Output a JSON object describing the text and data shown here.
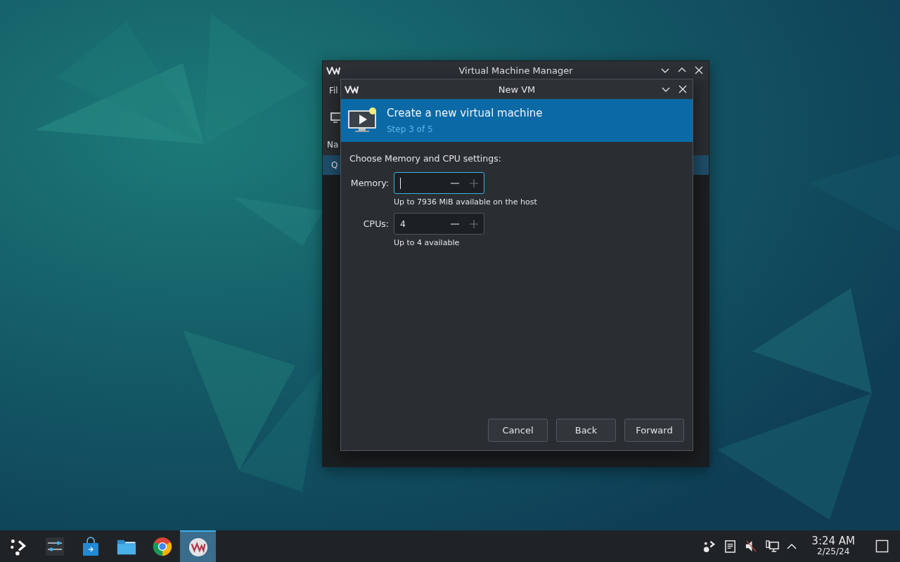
{
  "main_window": {
    "title": "Virtual Machine Manager",
    "menu_text": "Fil",
    "column_text": "Na",
    "row_text": "Q"
  },
  "dialog": {
    "title": "New VM",
    "header_title": "Create a new virtual machine",
    "header_step": "Step 3 of 5",
    "prompt": "Choose Memory and CPU settings:",
    "fields": [
      {
        "label": "Memory:",
        "focused": true,
        "hint": "Up to 7936 MiB available on the host"
      },
      {
        "label": "CPUs:",
        "value": "4",
        "focused": false,
        "hint": "Up to 4 available"
      }
    ],
    "buttons": [
      "Cancel",
      "Back",
      "Forward"
    ]
  },
  "taskbar": {
    "apps": [
      {
        "kind": "launcher",
        "selected": false
      },
      {
        "kind": "settings",
        "selected": false
      },
      {
        "kind": "store",
        "selected": false
      },
      {
        "kind": "folder",
        "selected": false
      },
      {
        "kind": "browser",
        "selected": false
      },
      {
        "kind": "vm",
        "selected": true
      }
    ],
    "tray": [
      {
        "kind": "network"
      },
      {
        "kind": "clipboard"
      },
      {
        "kind": "muted"
      },
      {
        "kind": "display"
      },
      {
        "kind": "expand"
      }
    ],
    "time": "3:24 AM",
    "date": "2/25/24"
  }
}
